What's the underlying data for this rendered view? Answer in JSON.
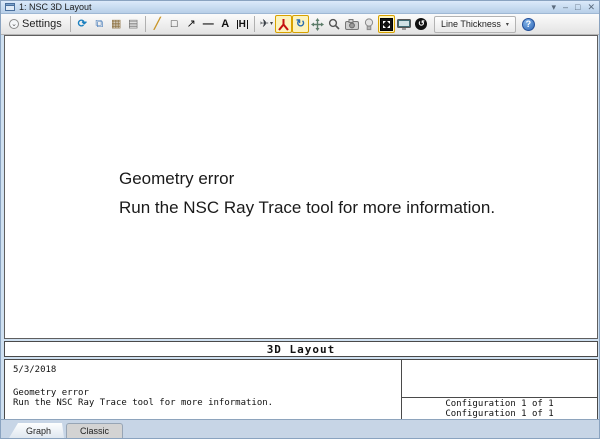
{
  "window": {
    "title": "1: NSC 3D Layout",
    "controls": {
      "menu": "▾",
      "minimize": "–",
      "maximize": "□",
      "close": "✕"
    }
  },
  "toolbar": {
    "settings_label": "Settings",
    "line_thickness_label": "Line Thickness",
    "dropdown_arrow": "▾",
    "icons": {
      "settings_chevron": "⌄",
      "refresh": "⟳",
      "copy": "⧉",
      "save_image": "▦",
      "print": "▤",
      "pencil": "╱",
      "rectangle": "□",
      "arrow": "↗",
      "line": "—",
      "text": "A",
      "measure": "H",
      "orientation": "✈",
      "rotate": "↻",
      "reset": "↺",
      "help": "?"
    },
    "svg_icon_names": [
      "axes-icon",
      "pan-icon",
      "zoom-icon",
      "camera-icon",
      "lightbulb-icon",
      "quadrant-icon",
      "monitor-icon"
    ],
    "toggled_on": [
      "axes-icon",
      "rotate-icon",
      "quadrant-icon"
    ]
  },
  "canvas": {
    "error_line1": "Geometry error",
    "error_line2": "Run the NSC Ray Trace tool for more information."
  },
  "plot_footer": {
    "band_title": "3D Layout",
    "date": "5/3/2018",
    "note_line1": "Geometry error",
    "note_line2": "Run the NSC Ray Trace tool for more information.",
    "config_line1": "Configuration 1 of 1",
    "config_line2": "Configuration 1 of 1"
  },
  "tabs": {
    "graph": "Graph",
    "classic": "Classic"
  },
  "colors": {
    "titlebar_top": "#dcEAfa",
    "titlebar_bottom": "#b7cfe8",
    "toolbar_highlight_bg": "#fdf3bd",
    "toolbar_highlight_border": "#d8a200",
    "help_blue": "#2f66b5",
    "tabbar_bg": "#c7d5e6",
    "canvas_border": "#5f5f5f"
  }
}
